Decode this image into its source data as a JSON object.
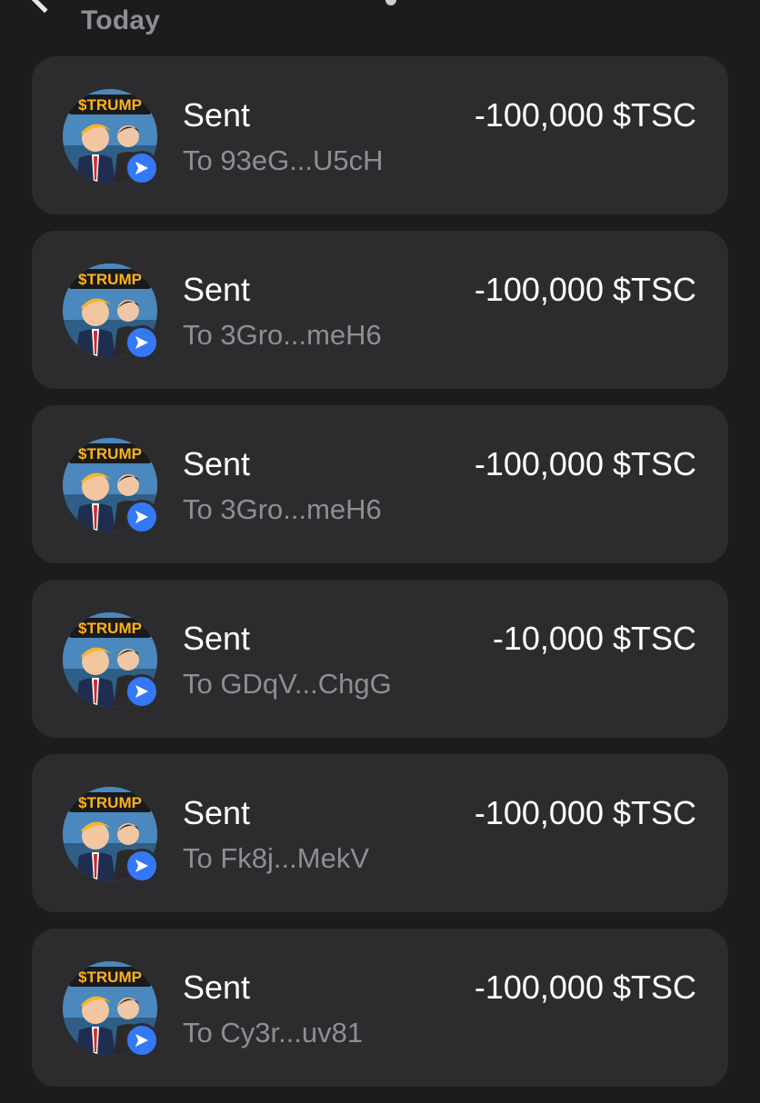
{
  "section": {
    "label": "Today"
  },
  "colors": {
    "background": "#1c1c1e",
    "card": "#2c2c2e",
    "badge": "#3478f6",
    "secondary_text": "#8e8e93"
  },
  "token": {
    "avatar_text": "$TRUMP",
    "avatar_icon": "token-avatar-icon",
    "badge_icon": "send-icon"
  },
  "transactions": [
    {
      "title": "Sent",
      "recipient": "To 93eG...U5cH",
      "amount": "-100,000 $TSC"
    },
    {
      "title": "Sent",
      "recipient": "To 3Gro...meH6",
      "amount": "-100,000 $TSC"
    },
    {
      "title": "Sent",
      "recipient": "To 3Gro...meH6",
      "amount": "-100,000 $TSC"
    },
    {
      "title": "Sent",
      "recipient": "To GDqV...ChgG",
      "amount": "-10,000 $TSC"
    },
    {
      "title": "Sent",
      "recipient": "To Fk8j...MekV",
      "amount": "-100,000 $TSC"
    },
    {
      "title": "Sent",
      "recipient": "To Cy3r...uv81",
      "amount": "-100,000 $TSC"
    }
  ]
}
